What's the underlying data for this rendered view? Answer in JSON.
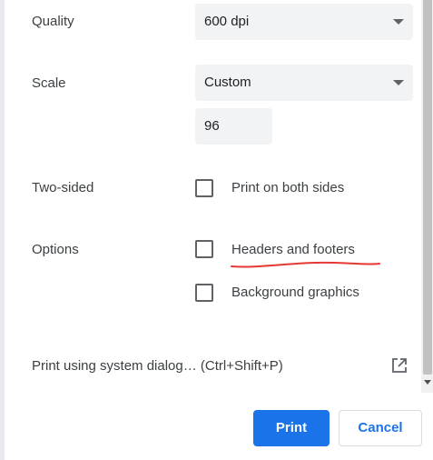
{
  "quality": {
    "label": "Quality",
    "value": "600 dpi"
  },
  "scale": {
    "label": "Scale",
    "value": "Custom",
    "custom_value": "96"
  },
  "two_sided": {
    "label": "Two-sided",
    "option_label": "Print on both sides",
    "checked": false
  },
  "options": {
    "label": "Options",
    "items": [
      {
        "label": "Headers and footers",
        "checked": false
      },
      {
        "label": "Background graphics",
        "checked": false
      }
    ]
  },
  "system_dialog": {
    "label": "Print using system dialog… (Ctrl+Shift+P)",
    "icon": "open-in-new-icon"
  },
  "buttons": {
    "print": "Print",
    "cancel": "Cancel"
  },
  "colors": {
    "accent": "#1a73e8",
    "annotation": "#e53935"
  }
}
